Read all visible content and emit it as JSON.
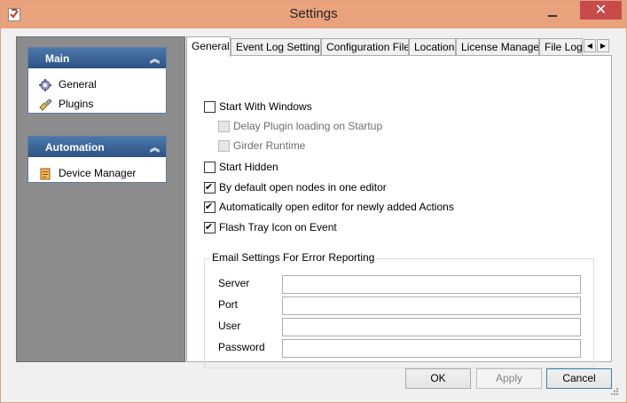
{
  "window": {
    "title": "Settings",
    "close_glyph": "✕",
    "accent_color": "#e9a27c"
  },
  "sidebar": {
    "groups": [
      {
        "title": "Main",
        "collapse_glyph": "︽",
        "items": [
          {
            "label": "General",
            "icon": "gear-icon"
          },
          {
            "label": "Plugins",
            "icon": "plugin-icon"
          }
        ]
      },
      {
        "title": "Automation",
        "collapse_glyph": "︽",
        "items": [
          {
            "label": "Device Manager",
            "icon": "device-manager-icon"
          }
        ]
      }
    ]
  },
  "tabs": {
    "items": [
      "General",
      "Event Log Settings",
      "Configuration Files",
      "Location",
      "License Manager",
      "File Logg"
    ],
    "active": "General",
    "scroll_left": "◀",
    "scroll_right": "▶"
  },
  "general": {
    "options": [
      {
        "label": "Start With Windows",
        "checked": false,
        "enabled": true
      },
      {
        "label": "Delay Plugin loading on Startup",
        "checked": false,
        "enabled": false
      },
      {
        "label": "Girder Runtime",
        "checked": false,
        "enabled": false
      },
      {
        "label": "Start Hidden",
        "checked": false,
        "enabled": true
      },
      {
        "label": "By default open nodes in one editor",
        "checked": true,
        "enabled": true
      },
      {
        "label": "Automatically open editor for newly added Actions",
        "checked": true,
        "enabled": true
      },
      {
        "label": "Flash Tray Icon on Event",
        "checked": true,
        "enabled": true
      }
    ],
    "email": {
      "legend": "Email Settings For Error Reporting",
      "fields": [
        {
          "label": "Server",
          "value": ""
        },
        {
          "label": "Port",
          "value": ""
        },
        {
          "label": "User",
          "value": ""
        },
        {
          "label": "Password",
          "value": ""
        }
      ]
    }
  },
  "buttons": {
    "ok": "OK",
    "apply": "Apply",
    "cancel": "Cancel"
  }
}
